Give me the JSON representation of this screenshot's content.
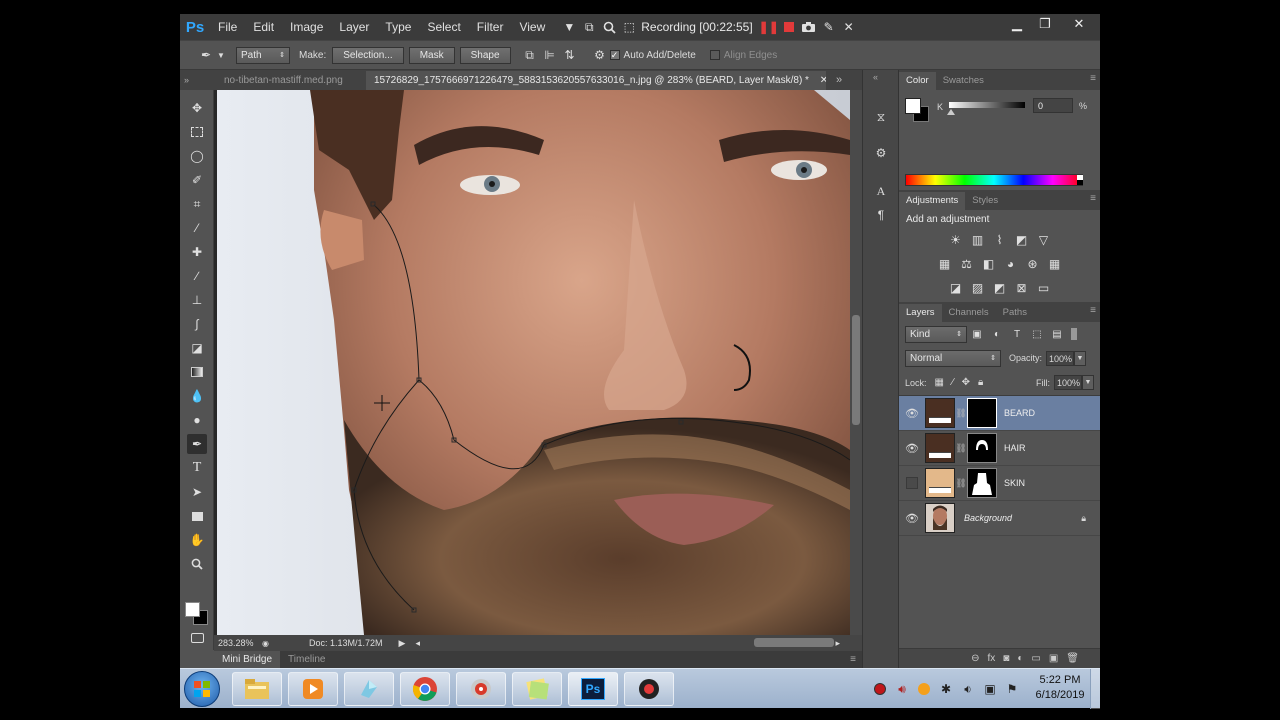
{
  "menubar": {
    "logo": "Ps",
    "items": [
      "File",
      "Edit",
      "Image",
      "Layer",
      "Type",
      "Select",
      "Filter",
      "View"
    ],
    "recording": "Recording [00:22:55]"
  },
  "options": {
    "mode_value": "Path",
    "make_label": "Make:",
    "selection_label": "Selection...",
    "mask_label": "Mask",
    "shape_label": "Shape",
    "auto_add_delete": "Auto Add/Delete",
    "align_edges": "Align Edges"
  },
  "tabs": [
    "no-tibetan-mastiff.med.png",
    "15726829_1757666971226479_5883153620557633016_n.jpg @ 283% (BEARD, Layer Mask/8) *"
  ],
  "status": {
    "zoom": "283.28%",
    "doc": "Doc: 1.13M/1.72M"
  },
  "bottom_tabs": [
    "Mini Bridge",
    "Timeline"
  ],
  "color_panel": {
    "tabs": [
      "Color",
      "Swatches"
    ],
    "channel_label": "K",
    "value": "0",
    "unit": "%"
  },
  "adjustments_panel": {
    "tabs": [
      "Adjustments",
      "Styles"
    ],
    "title": "Add an adjustment"
  },
  "layers_panel": {
    "tabs": [
      "Layers",
      "Channels",
      "Paths"
    ],
    "filter": "Kind",
    "blend_mode": "Normal",
    "opacity_label": "Opacity:",
    "opacity_value": "100%",
    "lock_label": "Lock:",
    "fill_label": "Fill:",
    "fill_value": "100%",
    "layers": [
      {
        "name": "BEARD",
        "color": "#4a2f22",
        "visible": true,
        "selected": true
      },
      {
        "name": "HAIR",
        "color": "#4a2f22",
        "visible": true,
        "selected": false
      },
      {
        "name": "SKIN",
        "color": "#e3b88a",
        "visible": false,
        "selected": false
      },
      {
        "name": "Background",
        "visible": true,
        "selected": false
      }
    ]
  },
  "taskbar": {
    "time": "5:22 PM",
    "date": "6/18/2019"
  }
}
